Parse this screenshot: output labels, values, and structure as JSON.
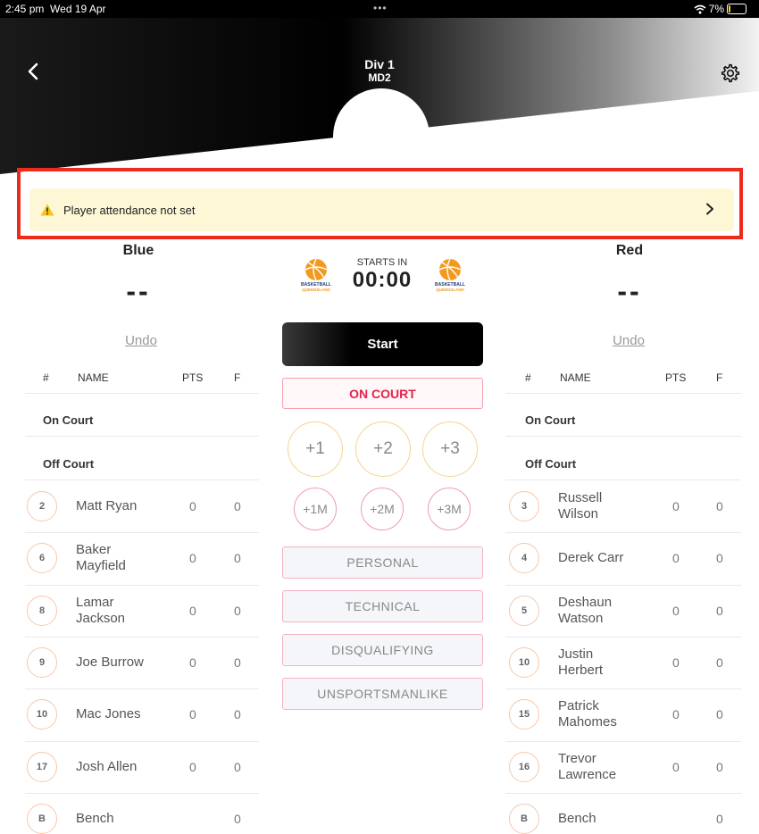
{
  "status_bar": {
    "time": "2:45 pm",
    "date": "Wed 19 Apr",
    "dots": "•••",
    "battery": "7%",
    "battery_level": 0.07
  },
  "header": {
    "title": "Div 1",
    "subtitle": "MD2"
  },
  "notice": {
    "text": "Player attendance not set"
  },
  "scoreboard": {
    "starts_label": "STARTS IN",
    "timer": "00:00",
    "logo_text_top": "BASKETBALL",
    "logo_text_bottom": "QUEENSLAND"
  },
  "home": {
    "name": "Blue",
    "score": "--",
    "undo": "Undo",
    "columns": {
      "num": "#",
      "name": "NAME",
      "pts": "PTS",
      "f": "F"
    },
    "on_court": "On Court",
    "off_court": "Off Court",
    "players": [
      {
        "num": "2",
        "name": "Matt Ryan",
        "pts": "0",
        "f": "0"
      },
      {
        "num": "6",
        "name": "Baker\nMayfield",
        "pts": "0",
        "f": "0"
      },
      {
        "num": "8",
        "name": "Lamar\nJackson",
        "pts": "0",
        "f": "0"
      },
      {
        "num": "9",
        "name": "Joe Burrow",
        "pts": "0",
        "f": "0"
      },
      {
        "num": "10",
        "name": "Mac Jones",
        "pts": "0",
        "f": "0"
      },
      {
        "num": "17",
        "name": "Josh Allen",
        "pts": "0",
        "f": "0"
      },
      {
        "num": "B",
        "name": "Bench",
        "pts": "",
        "f": "0"
      }
    ]
  },
  "away": {
    "name": "Red",
    "score": "--",
    "undo": "Undo",
    "columns": {
      "num": "#",
      "name": "NAME",
      "pts": "PTS",
      "f": "F"
    },
    "on_court": "On Court",
    "off_court": "Off Court",
    "players": [
      {
        "num": "3",
        "name": "Russell\nWilson",
        "pts": "0",
        "f": "0"
      },
      {
        "num": "4",
        "name": "Derek Carr",
        "pts": "0",
        "f": "0"
      },
      {
        "num": "5",
        "name": "Deshaun\nWatson",
        "pts": "0",
        "f": "0"
      },
      {
        "num": "10",
        "name": "Justin\nHerbert",
        "pts": "0",
        "f": "0"
      },
      {
        "num": "15",
        "name": "Patrick\nMahomes",
        "pts": "0",
        "f": "0"
      },
      {
        "num": "16",
        "name": "Trevor\nLawrence",
        "pts": "0",
        "f": "0"
      },
      {
        "num": "B",
        "name": "Bench",
        "pts": "",
        "f": "0"
      }
    ]
  },
  "controls": {
    "start": "Start",
    "on_court": "ON COURT",
    "score_buttons": [
      "+1",
      "+2",
      "+3"
    ],
    "miss_buttons": [
      "+1M",
      "+2M",
      "+3M"
    ],
    "fouls": [
      "PERSONAL",
      "TECHNICAL",
      "DISQUALIFYING",
      "UNSPORTSMANLIKE"
    ]
  },
  "colors": {
    "accent_red": "#e4234b",
    "warning_bg": "#fdf7d6",
    "highlight": "#ee2a1b",
    "battery": "#ffd60a"
  }
}
